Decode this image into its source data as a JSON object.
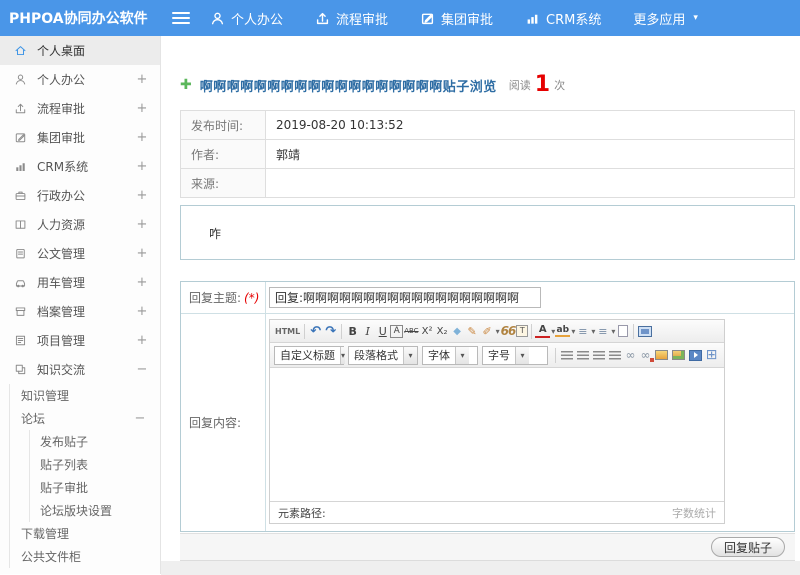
{
  "colors": {
    "topbar_blue": "#4a96e8",
    "title_blue": "#2e6da4",
    "count_red": "#e60000",
    "plus_green": "#5bb75b",
    "panel_border": "#b4ccd4"
  },
  "topbar": {
    "brand": "PHPOA协同办公软件",
    "nav": [
      {
        "label": "个人办公",
        "icon": "user-icon"
      },
      {
        "label": "流程审批",
        "icon": "flow-approve-icon"
      },
      {
        "label": "集团审批",
        "icon": "edit-approve-icon"
      },
      {
        "label": "CRM系统",
        "icon": "bar-chart-icon"
      },
      {
        "label": "更多应用",
        "icon": "caret-down-icon",
        "caret": "▾"
      }
    ]
  },
  "sidebar": {
    "items": [
      {
        "label": "个人桌面",
        "toggle": ""
      },
      {
        "label": "个人办公",
        "toggle": "+"
      },
      {
        "label": "流程审批",
        "toggle": "+"
      },
      {
        "label": "集团审批",
        "toggle": "+"
      },
      {
        "label": "CRM系统",
        "toggle": "+"
      },
      {
        "label": "行政办公",
        "toggle": "+"
      },
      {
        "label": "人力资源",
        "toggle": "+"
      },
      {
        "label": "公文管理",
        "toggle": "+"
      },
      {
        "label": "用车管理",
        "toggle": "+"
      },
      {
        "label": "档案管理",
        "toggle": "+"
      },
      {
        "label": "项目管理",
        "toggle": "+"
      },
      {
        "label": "知识交流",
        "toggle": "−"
      }
    ],
    "knowledge_sub": {
      "item_knowledge_mgmt": "知识管理",
      "forum": {
        "label": "论坛",
        "toggle": "−",
        "children": [
          "发布贴子",
          "贴子列表",
          "贴子审批",
          "论坛版块设置"
        ]
      },
      "item_download_mgmt": "下载管理",
      "item_public_cabinet": "公共文件柜"
    }
  },
  "content": {
    "plus_icon": "✚",
    "title": "啊啊啊啊啊啊啊啊啊啊啊啊啊啊啊啊啊啊贴子浏览",
    "read_label": "阅读",
    "read_count": "1",
    "read_unit": "次",
    "info": [
      {
        "label": "发布时间:",
        "value": "2019-08-20 10:13:52"
      },
      {
        "label": "作者:",
        "value": "郭靖"
      },
      {
        "label": "来源:",
        "value": ""
      }
    ],
    "post_body": "咋",
    "reply": {
      "subject_label": "回复主题:",
      "required": "(*)",
      "subject_value": "回复:啊啊啊啊啊啊啊啊啊啊啊啊啊啊啊啊啊啊",
      "content_label": "回复内容:",
      "submit": "回复贴子"
    }
  },
  "editor": {
    "glyphs": {
      "html": "HTML",
      "undo": "↶",
      "redo": "↷",
      "bold": "B",
      "italic": "I",
      "underline": "U",
      "font_border": "A",
      "strike": "ABC",
      "sup": "X²",
      "sub": "X₂",
      "eraser": "◆",
      "brush": "✎",
      "paint": "✐",
      "quote": "66",
      "paste": "T",
      "font_color": "A",
      "highlight": "ab",
      "list_ol": "≡",
      "list_ul": "≡",
      "caret": "▾",
      "link": "∞",
      "anchor": "∞",
      "table": "⊞"
    },
    "selects": [
      "自定义标题",
      "段落格式",
      "字体",
      "字号"
    ],
    "footer_left": "元素路径:",
    "footer_right": "字数统计"
  }
}
